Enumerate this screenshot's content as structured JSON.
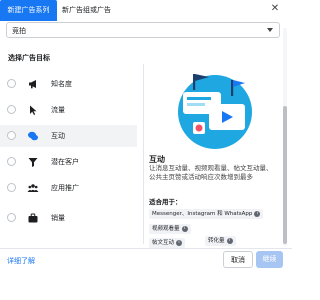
{
  "tabs": [
    {
      "label": "新建广告系列",
      "active": true
    },
    {
      "label": "新广告组或广告",
      "active": false
    }
  ],
  "buying_type": {
    "value": "竞拍"
  },
  "objective_section": {
    "title": "选择广告目标"
  },
  "objectives": [
    {
      "label": "知名度",
      "icon": "megaphone-icon"
    },
    {
      "label": "流量",
      "icon": "cursor-icon"
    },
    {
      "label": "互动",
      "icon": "chat-bubbles-icon"
    },
    {
      "label": "潜在客户",
      "icon": "funnel-icon"
    },
    {
      "label": "应用推广",
      "icon": "people-icon"
    },
    {
      "label": "销量",
      "icon": "briefcase-icon"
    }
  ],
  "selected_objective": "互动",
  "detail": {
    "title": "互动",
    "description": "让消息互动量、视频观看量、帖文互动量、公共主页赞或活动响应次数增到最多",
    "suitable_label": "适合用于：",
    "use_cases": [
      "Messenger、Instagram 和 WhatsApp",
      "视频观看量",
      "帖文互动",
      "转化量"
    ]
  },
  "footer": {
    "learn_more": "详细了解",
    "cancel": "取消",
    "continue": "继续"
  },
  "colors": {
    "accent": "#1877f2",
    "selected_row": "#f2f3f5",
    "disabled_button": "#a7c5f2"
  }
}
